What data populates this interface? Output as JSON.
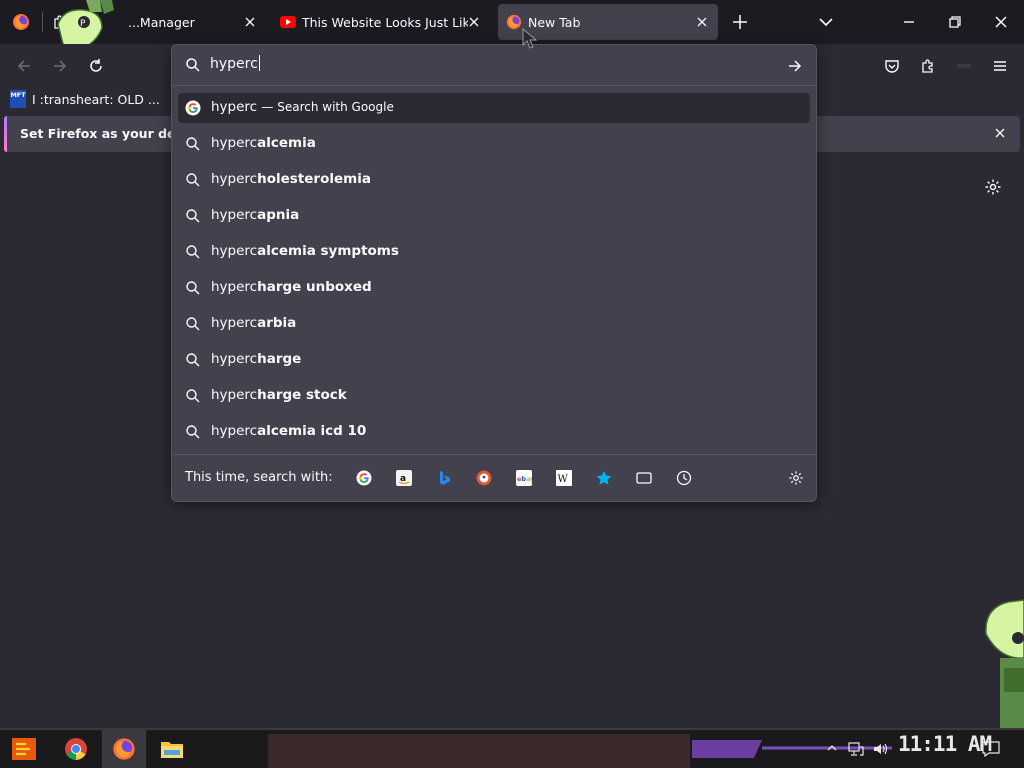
{
  "tabs": [
    {
      "title": "...Manager",
      "active": false
    },
    {
      "title": "This Website Looks Just Like",
      "active": false
    },
    {
      "title": "New Tab",
      "active": true
    }
  ],
  "bookmarks": [
    {
      "icon_text": "MFT",
      "label": "I :transheart: OLD ..."
    }
  ],
  "notification": {
    "text": "Set Firefox as your defau"
  },
  "urlbar": {
    "query": "hyperc",
    "heuristic": {
      "query": "hyperc",
      "action": "— Search with Google"
    },
    "suggestions": [
      {
        "prefix": "hyperc",
        "completion": "alcemia"
      },
      {
        "prefix": "hyperc",
        "completion": "holesterolemia"
      },
      {
        "prefix": "hyperc",
        "completion": "apnia"
      },
      {
        "prefix": "hyperc",
        "completion": "alcemia symptoms"
      },
      {
        "prefix": "hyperc",
        "completion": "harge unboxed"
      },
      {
        "prefix": "hyperc",
        "completion": "arbia"
      },
      {
        "prefix": "hyperc",
        "completion": "harge"
      },
      {
        "prefix": "hyperc",
        "completion": "harge stock"
      },
      {
        "prefix": "hyperc",
        "completion": "alcemia icd 10"
      }
    ],
    "oneoff_label": "This time, search with:",
    "engines": [
      "google-icon",
      "amazon-icon",
      "bing-icon",
      "duckduckgo-icon",
      "ebay-icon",
      "wikipedia-icon",
      "bookmarks-icon",
      "tabs-icon",
      "history-icon"
    ]
  },
  "taskbar": {
    "clock": "11:11 AM"
  },
  "colors": {
    "accent": "#a97bff",
    "surface": "#42414d",
    "background": "#2b2a33"
  }
}
